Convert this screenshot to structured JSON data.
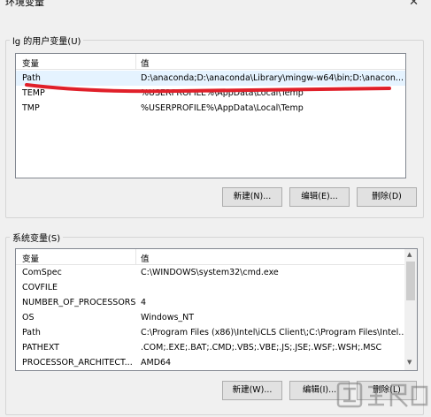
{
  "window": {
    "title": "环境变量"
  },
  "user_vars": {
    "group_label": "lg 的用户变量(U)",
    "col_var": "变量",
    "col_val": "值",
    "rows": [
      {
        "name": "Path",
        "value": "D:\\anaconda;D:\\anaconda\\Library\\mingw-w64\\bin;D:\\anacon..."
      },
      {
        "name": "TEMP",
        "value": "%USERPROFILE%\\AppData\\Local\\Temp"
      },
      {
        "name": "TMP",
        "value": "%USERPROFILE%\\AppData\\Local\\Temp"
      }
    ],
    "new_label": "新建(N)...",
    "edit_label": "编辑(E)...",
    "delete_label": "删除(D)"
  },
  "sys_vars": {
    "group_label": "系统变量(S)",
    "col_var": "变量",
    "col_val": "值",
    "rows": [
      {
        "name": "ComSpec",
        "value": "C:\\WINDOWS\\system32\\cmd.exe"
      },
      {
        "name": "COVFILE",
        "value": ""
      },
      {
        "name": "NUMBER_OF_PROCESSORS",
        "value": "4"
      },
      {
        "name": "OS",
        "value": "Windows_NT"
      },
      {
        "name": "Path",
        "value": "C:\\Program Files (x86)\\Intel\\iCLS Client\\;C:\\Program Files\\Intel..."
      },
      {
        "name": "PATHEXT",
        "value": ".COM;.EXE;.BAT;.CMD;.VBS;.VBE;.JS;.JSE;.WSF;.WSH;.MSC"
      },
      {
        "name": "PROCESSOR_ARCHITECT...",
        "value": "AMD64"
      }
    ],
    "new_label": "新建(W)...",
    "edit_label": "编辑(I)...",
    "delete_label": "删除(L)"
  },
  "colors": {
    "annotation": "#e0202a",
    "selection": "#e5f3ff"
  }
}
